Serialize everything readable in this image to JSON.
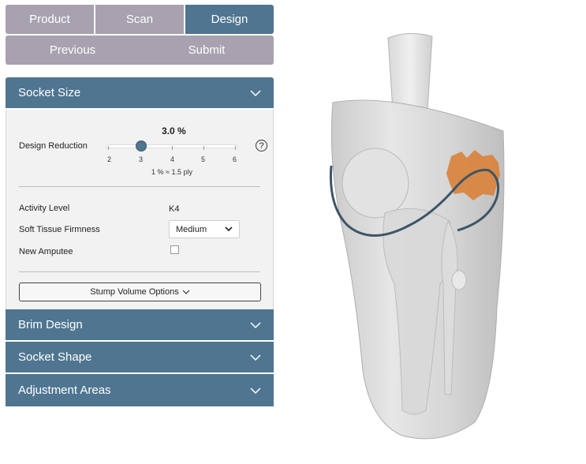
{
  "tabs": [
    {
      "label": "Product",
      "active": false
    },
    {
      "label": "Scan",
      "active": false
    },
    {
      "label": "Design",
      "active": true
    }
  ],
  "nav": {
    "previous": "Previous",
    "submit": "Submit"
  },
  "socket_size": {
    "title": "Socket Size",
    "design_reduction": {
      "label": "Design Reduction",
      "value_text": "3.0 %",
      "value": 3.0,
      "min": 2,
      "max": 6,
      "ticks": [
        "2",
        "3",
        "4",
        "5",
        "6"
      ],
      "ply_note": "1 % ≈ 1.5 ply",
      "help": "?"
    },
    "activity_level": {
      "label": "Activity Level",
      "value": "K4"
    },
    "soft_tissue": {
      "label": "Soft Tissue Firmness",
      "value": "Medium"
    },
    "new_amputee": {
      "label": "New Amputee",
      "checked": false
    },
    "stump_volume_button": "Stump Volume Options"
  },
  "sections": {
    "brim_design": "Brim Design",
    "socket_shape": "Socket Shape",
    "adjustment_areas": "Adjustment Areas"
  },
  "colors": {
    "accent": "#4f7590",
    "tab_inactive": "#a8a1af",
    "adjustment_area": "#d9823a",
    "trim_line": "#3d5568"
  }
}
